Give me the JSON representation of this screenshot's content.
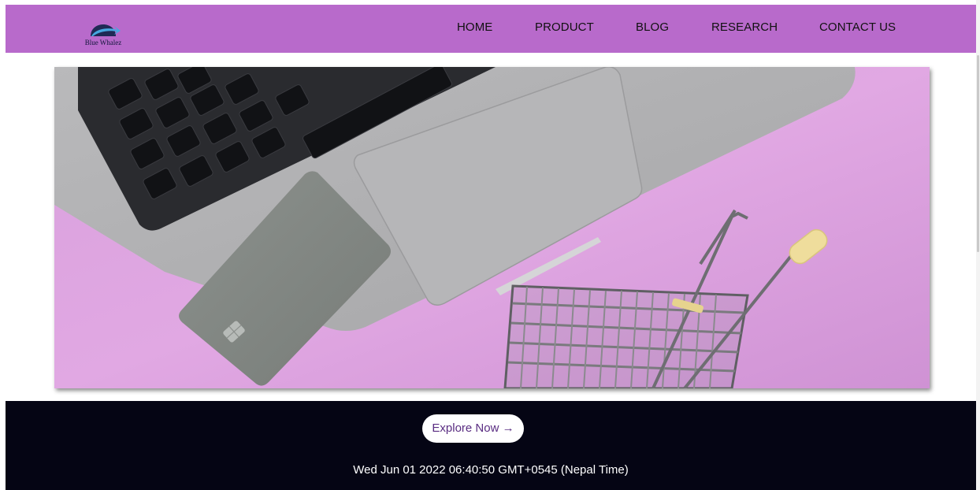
{
  "brand": {
    "name": "Blue Whalez",
    "logo_icon": "whale-arch-icon",
    "color": "#b86acb"
  },
  "nav": {
    "items": [
      {
        "label": "HOME"
      },
      {
        "label": "PRODUCT"
      },
      {
        "label": "BLOG"
      },
      {
        "label": "RESEARCH"
      },
      {
        "label": "CONTACT US"
      }
    ]
  },
  "hero": {
    "image": "laptop-card-shopping-cart-photo",
    "background_color": "#d79ddb"
  },
  "footer": {
    "cta_label": "Explore Now →",
    "datetime": "Wed Jun 01 2022 06:40:50 GMT+0545 (Nepal Time)",
    "background_color": "#050514"
  }
}
